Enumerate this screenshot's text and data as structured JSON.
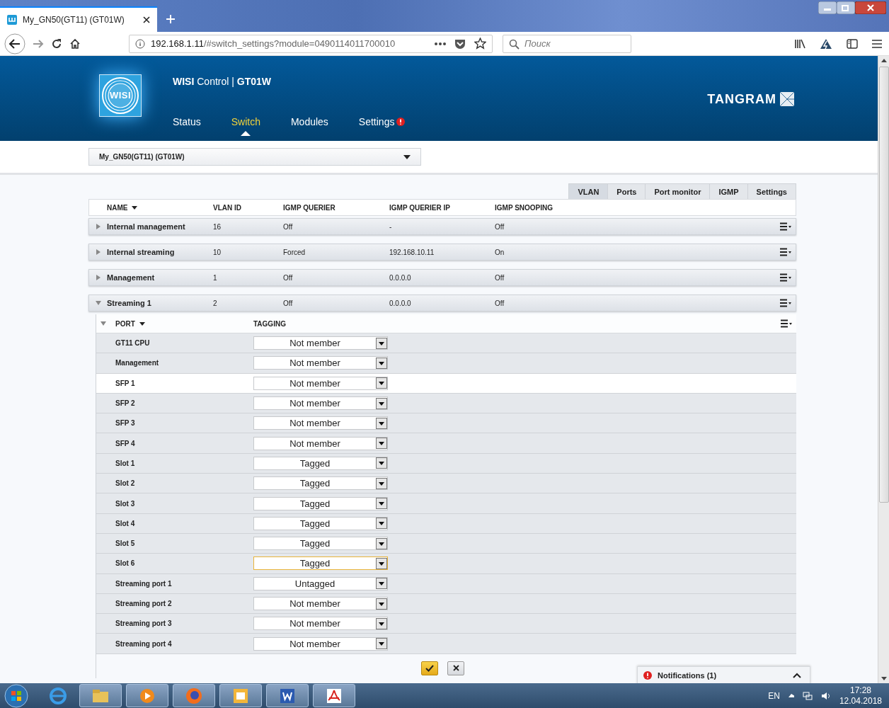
{
  "browser": {
    "tab_title": "My_GN50(GT11) (GT01W)",
    "url_host": "192.168.1.11",
    "url_path": "/#switch_settings?module=0490114011700010",
    "search_placeholder": "Поиск"
  },
  "header": {
    "logo_text": "WISI",
    "brand": "WISI",
    "product": "Control | ",
    "device": "GT01W",
    "partner_logo": "TANGRAM",
    "nav": [
      {
        "label": "Status",
        "selected": false,
        "alert": false
      },
      {
        "label": "Switch",
        "selected": true,
        "alert": false
      },
      {
        "label": "Modules",
        "selected": false,
        "alert": false
      },
      {
        "label": "Settings",
        "selected": false,
        "alert": true
      }
    ]
  },
  "device_select": {
    "value": "My_GN50(GT11) (GT01W)"
  },
  "tabs": [
    {
      "label": "VLAN",
      "selected": true
    },
    {
      "label": "Ports",
      "selected": false
    },
    {
      "label": "Port monitor",
      "selected": false
    },
    {
      "label": "IGMP",
      "selected": false
    },
    {
      "label": "Settings",
      "selected": false
    }
  ],
  "table": {
    "columns": [
      "NAME",
      "VLAN ID",
      "IGMP QUERIER",
      "IGMP QUERIER IP",
      "IGMP SNOOPING"
    ],
    "rows": [
      {
        "name": "Internal management",
        "vlan_id": "16",
        "querier": "Off",
        "querier_ip": "-",
        "snooping": "Off",
        "expanded": false
      },
      {
        "name": "Internal streaming",
        "vlan_id": "10",
        "querier": "Forced",
        "querier_ip": "192.168.10.11",
        "snooping": "On",
        "expanded": false
      },
      {
        "name": "Management",
        "vlan_id": "1",
        "querier": "Off",
        "querier_ip": "0.0.0.0",
        "snooping": "Off",
        "expanded": false
      },
      {
        "name": "Streaming 1",
        "vlan_id": "2",
        "querier": "Off",
        "querier_ip": "0.0.0.0",
        "snooping": "Off",
        "expanded": true,
        "ports": {
          "columns": [
            "PORT",
            "TAGGING"
          ],
          "rows": [
            {
              "name": "GT11 CPU",
              "tagging": "Not member",
              "highlighted": false,
              "focused": false
            },
            {
              "name": "Management",
              "tagging": "Not member",
              "highlighted": false,
              "focused": false
            },
            {
              "name": "SFP 1",
              "tagging": "Not member",
              "highlighted": true,
              "focused": false
            },
            {
              "name": "SFP 2",
              "tagging": "Not member",
              "highlighted": false,
              "focused": false
            },
            {
              "name": "SFP 3",
              "tagging": "Not member",
              "highlighted": false,
              "focused": false
            },
            {
              "name": "SFP 4",
              "tagging": "Not member",
              "highlighted": false,
              "focused": false
            },
            {
              "name": "Slot 1",
              "tagging": "Tagged",
              "highlighted": false,
              "focused": false
            },
            {
              "name": "Slot 2",
              "tagging": "Tagged",
              "highlighted": false,
              "focused": false
            },
            {
              "name": "Slot 3",
              "tagging": "Tagged",
              "highlighted": false,
              "focused": false
            },
            {
              "name": "Slot 4",
              "tagging": "Tagged",
              "highlighted": false,
              "focused": false
            },
            {
              "name": "Slot 5",
              "tagging": "Tagged",
              "highlighted": false,
              "focused": false
            },
            {
              "name": "Slot 6",
              "tagging": "Tagged",
              "highlighted": false,
              "focused": true
            },
            {
              "name": "Streaming port 1",
              "tagging": "Untagged",
              "highlighted": false,
              "focused": false
            },
            {
              "name": "Streaming port 2",
              "tagging": "Not member",
              "highlighted": false,
              "focused": false
            },
            {
              "name": "Streaming port 3",
              "tagging": "Not member",
              "highlighted": false,
              "focused": false
            },
            {
              "name": "Streaming port 4",
              "tagging": "Not member",
              "highlighted": false,
              "focused": false
            }
          ]
        }
      }
    ]
  },
  "notifications": {
    "label": "Notifications (1)"
  },
  "taskbar": {
    "language": "EN",
    "time": "17:28",
    "date": "12.04.2018"
  }
}
